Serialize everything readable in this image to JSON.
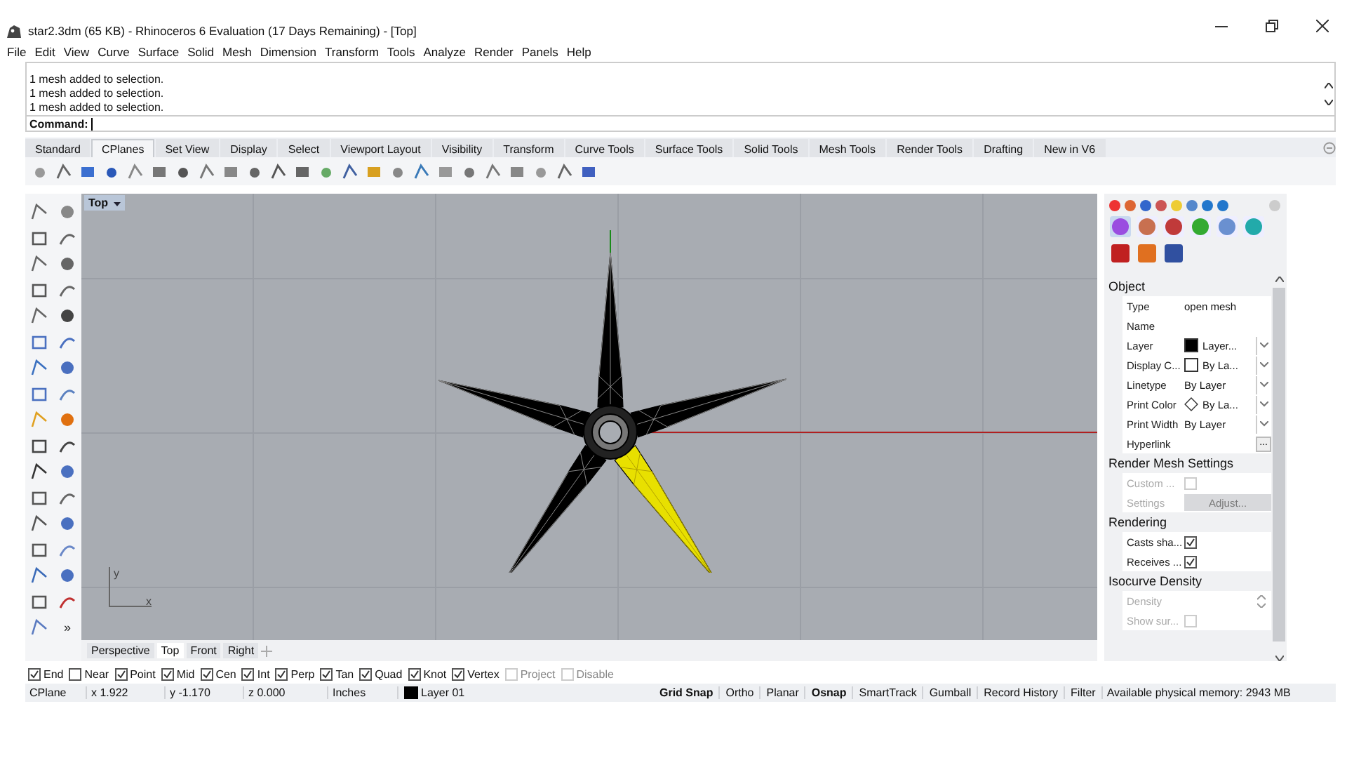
{
  "window": {
    "title": "star2.3dm (65 KB) - Rhinoceros 6 Evaluation (17 Days Remaining) - [Top]"
  },
  "menu": [
    "File",
    "Edit",
    "View",
    "Curve",
    "Surface",
    "Solid",
    "Mesh",
    "Dimension",
    "Transform",
    "Tools",
    "Analyze",
    "Render",
    "Panels",
    "Help"
  ],
  "command_history": [
    "1 mesh added to selection.",
    "1 mesh added to selection.",
    "1 mesh added to selection."
  ],
  "command": {
    "prompt": "Command:"
  },
  "toolbar_tabs": [
    {
      "label": "Standard",
      "selected": false
    },
    {
      "label": "CPlanes",
      "selected": true
    },
    {
      "label": "Set View",
      "selected": false
    },
    {
      "label": "Display",
      "selected": false
    },
    {
      "label": "Select",
      "selected": false
    },
    {
      "label": "Viewport Layout",
      "selected": false
    },
    {
      "label": "Visibility",
      "selected": false
    },
    {
      "label": "Transform",
      "selected": false
    },
    {
      "label": "Curve Tools",
      "selected": false
    },
    {
      "label": "Surface Tools",
      "selected": false
    },
    {
      "label": "Solid Tools",
      "selected": false
    },
    {
      "label": "Mesh Tools",
      "selected": false
    },
    {
      "label": "Render Tools",
      "selected": false
    },
    {
      "label": "Drafting",
      "selected": false
    },
    {
      "label": "New in V6",
      "selected": false
    }
  ],
  "viewport": {
    "title": "Top",
    "axis_y": "y",
    "axis_x": "x"
  },
  "left_toolbar": {
    "more": "»"
  },
  "properties": [
    {
      "title": "Object",
      "rows": [
        {
          "kind": "text",
          "label": "Type",
          "value": "open mesh"
        },
        {
          "kind": "text",
          "label": "Name"
        },
        {
          "kind": "dropdown",
          "label": "Layer",
          "value": "Layer...",
          "swatch": {
            "kind": "filled"
          }
        },
        {
          "kind": "dropdown",
          "label": "Display C...",
          "value": "By La...",
          "swatch": {
            "kind": "empty"
          }
        },
        {
          "kind": "dropdown",
          "label": "Linetype",
          "value": "By Layer"
        },
        {
          "kind": "dropdown",
          "label": "Print Color",
          "value": "By La...",
          "swatch": {
            "kind": "diamond"
          }
        },
        {
          "kind": "dropdown",
          "label": "Print Width",
          "value": "By Layer"
        },
        {
          "kind": "button",
          "label": "Hyperlink",
          "value": "..."
        }
      ]
    },
    {
      "title": "Render Mesh Settings",
      "rows": [
        {
          "kind": "checkbox",
          "label": "Custom ...",
          "checked": false,
          "disabled": true
        },
        {
          "kind": "action",
          "label": "Settings",
          "value": "Adjust...",
          "disabled": true
        }
      ]
    },
    {
      "title": "Rendering",
      "rows": [
        {
          "kind": "checkbox",
          "label": "Casts sha...",
          "checked": true,
          "disabled": false
        },
        {
          "kind": "checkbox",
          "label": "Receives ...",
          "checked": true,
          "disabled": false
        }
      ]
    },
    {
      "title": "Isocurve Density",
      "rows": [
        {
          "kind": "spinner",
          "label": "Density",
          "disabled": true
        },
        {
          "kind": "checkbox",
          "label": "Show sur...",
          "checked": false,
          "disabled": true
        }
      ]
    }
  ],
  "viewport_tabs": [
    {
      "label": "Perspective",
      "selected": false
    },
    {
      "label": "Top",
      "selected": true
    },
    {
      "label": "Front",
      "selected": false
    },
    {
      "label": "Right",
      "selected": false
    }
  ],
  "osnaps": [
    {
      "label": "End",
      "checked": true,
      "disabled": false
    },
    {
      "label": "Near",
      "checked": false,
      "disabled": false
    },
    {
      "label": "Point",
      "checked": true,
      "disabled": false
    },
    {
      "label": "Mid",
      "checked": true,
      "disabled": false
    },
    {
      "label": "Cen",
      "checked": true,
      "disabled": false
    },
    {
      "label": "Int",
      "checked": true,
      "disabled": false
    },
    {
      "label": "Perp",
      "checked": true,
      "disabled": false
    },
    {
      "label": "Tan",
      "checked": true,
      "disabled": false
    },
    {
      "label": "Quad",
      "checked": true,
      "disabled": false
    },
    {
      "label": "Knot",
      "checked": true,
      "disabled": false
    },
    {
      "label": "Vertex",
      "checked": true,
      "disabled": false
    },
    {
      "label": "Project",
      "checked": false,
      "disabled": true
    },
    {
      "label": "Disable",
      "checked": false,
      "disabled": true
    }
  ],
  "status_bar": {
    "fields": [
      "CPlane",
      "x 1.922",
      "y -1.170",
      "z 0.000",
      "Inches"
    ],
    "layer": "Layer 01",
    "toggles": [
      {
        "label": "Grid Snap",
        "on": true
      },
      {
        "label": "Ortho",
        "on": false
      },
      {
        "label": "Planar",
        "on": false
      },
      {
        "label": "Osnap",
        "on": true
      },
      {
        "label": "SmartTrack",
        "on": false
      },
      {
        "label": "Gumball",
        "on": false
      },
      {
        "label": "Record History",
        "on": false
      },
      {
        "label": "Filter",
        "on": false
      }
    ],
    "memory": "Available physical memory: 2943 MB"
  }
}
